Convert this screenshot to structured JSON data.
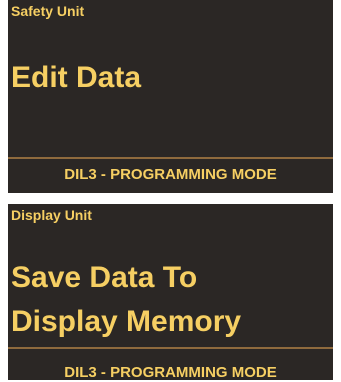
{
  "safety_panel": {
    "unit_label": "Safety Unit",
    "message": "Edit Data",
    "mode": "DIL3 - PROGRAMMING MODE"
  },
  "display_panel": {
    "unit_label": "Display Unit",
    "message_line1": "Save Data To",
    "message_line2": "Display Memory",
    "mode": "DIL3 - PROGRAMMING MODE"
  },
  "colors": {
    "panel_background": "#2b2725",
    "text": "#f6cf63",
    "divider": "#8f6a3d"
  }
}
